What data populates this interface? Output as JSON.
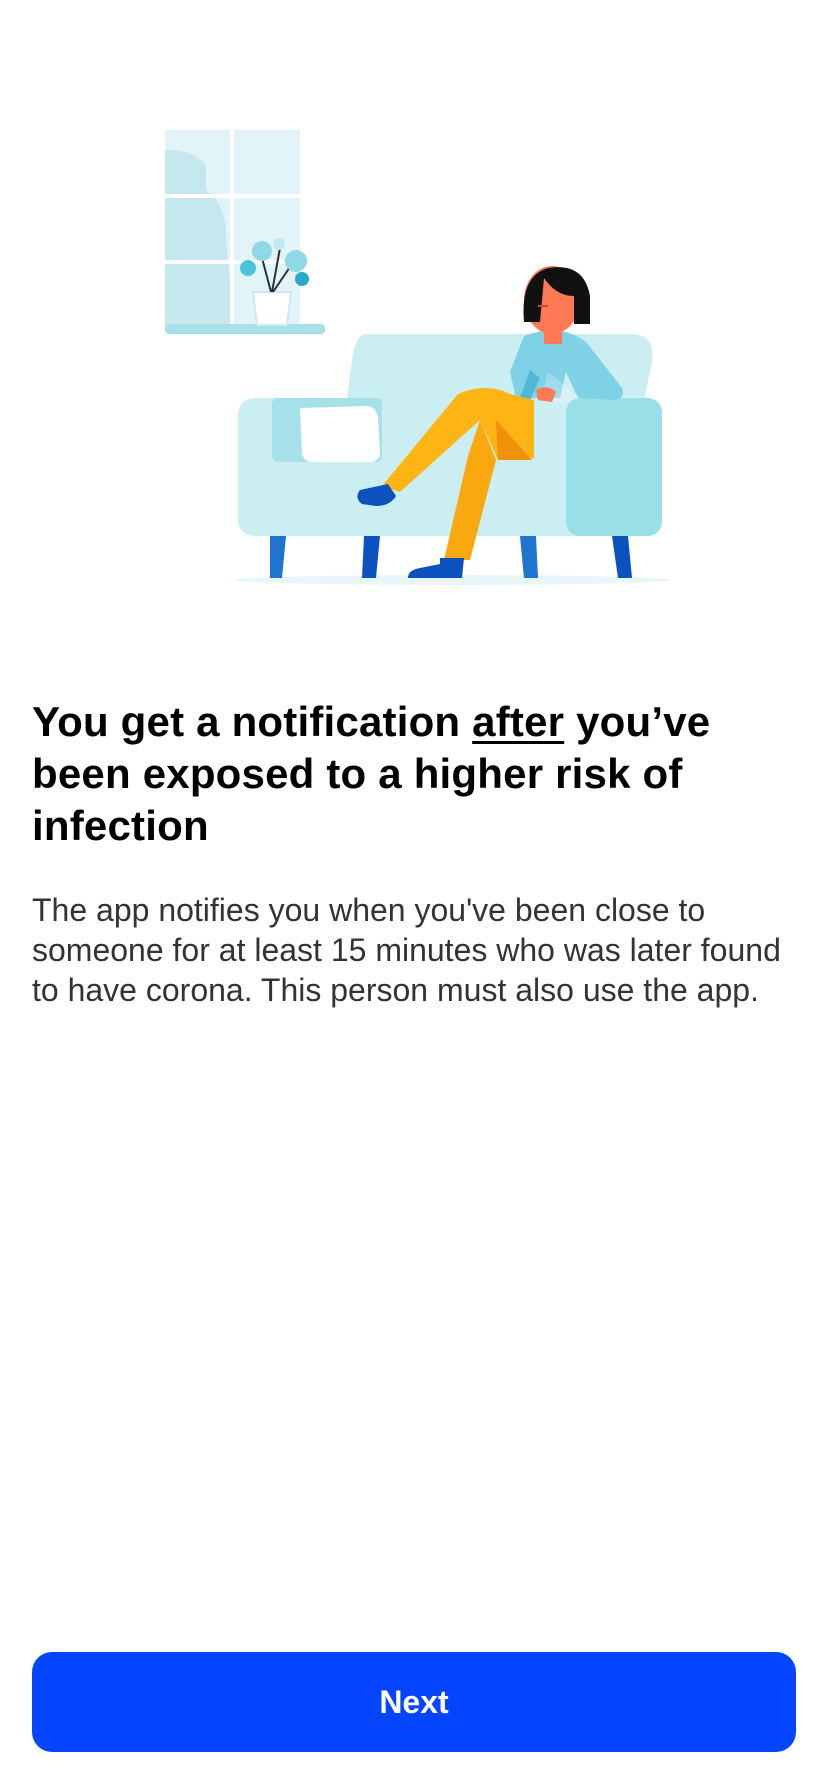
{
  "onboarding": {
    "illustration_name": "woman-resting-on-sofa",
    "title_before": "You get a notification ",
    "title_emphasis": "after",
    "title_after": " you’ve been exposed to a higher risk of infection",
    "description": "The app notifies you when you've been close to someone for at least 15 minutes who was later found to have corona. This person must also use the app.",
    "next_label": "Next"
  },
  "colors": {
    "primary": "#0645ff",
    "heading": "#000000",
    "body": "#333333",
    "sofa": "#cbeef2",
    "sofa_dark": "#98dfe7",
    "legs": "#1e74ce",
    "pants": "#ffb416",
    "shirt": "#7fd2e6",
    "skin": "#ff7954"
  }
}
